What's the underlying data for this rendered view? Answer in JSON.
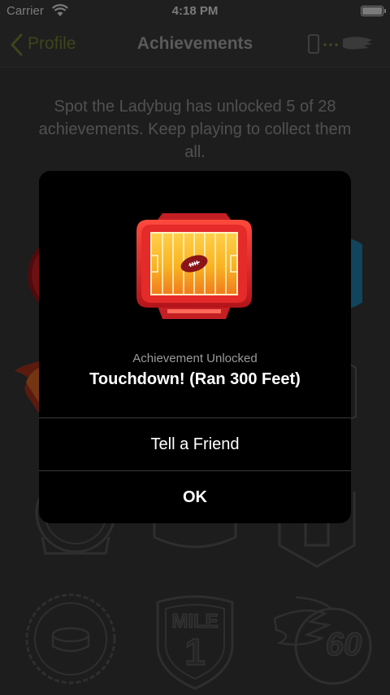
{
  "status_bar": {
    "carrier": "Carrier",
    "time": "4:18 PM"
  },
  "nav": {
    "back_label": "Profile",
    "title": "Achievements"
  },
  "intro_text": "Spot the Ladybug has unlocked 5 of 28 achievements. Keep playing to collect them all.",
  "background_badges": [
    {
      "text": "MILE"
    },
    {
      "text": "1"
    },
    {
      "text": "60"
    }
  ],
  "dialog": {
    "subtitle": "Achievement Unlocked",
    "title": "Touchdown! (Ran 300 Feet)",
    "tell_friend_label": "Tell a Friend",
    "ok_label": "OK"
  },
  "colors": {
    "accent": "#5f6b2b",
    "badge_red": "#d8262b",
    "badge_gold": "#f4b623",
    "modal_bg": "#000000",
    "screen_bg": "#2d2d2d"
  }
}
